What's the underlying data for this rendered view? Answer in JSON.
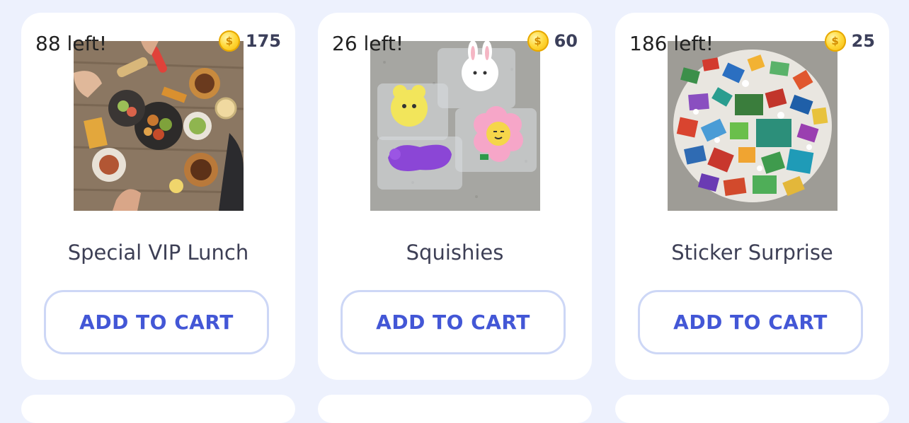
{
  "colors": {
    "page_background": "#edf1fd",
    "card_background": "#ffffff",
    "button_text": "#4357d6",
    "button_border": "#cdd7f6",
    "coin": "#f3b200"
  },
  "products": [
    {
      "stock": "88 left!",
      "price": "175",
      "name": "Special VIP Lunch",
      "button": "ADD TO CART",
      "image_icon": "food-platter-photo"
    },
    {
      "stock": "26 left!",
      "price": "60",
      "name": "Squishies",
      "button": "ADD TO CART",
      "image_icon": "squishy-toys-photo"
    },
    {
      "stock": "186 left!",
      "price": "25",
      "name": "Sticker Surprise",
      "button": "ADD TO CART",
      "image_icon": "stickers-pile-photo"
    }
  ]
}
